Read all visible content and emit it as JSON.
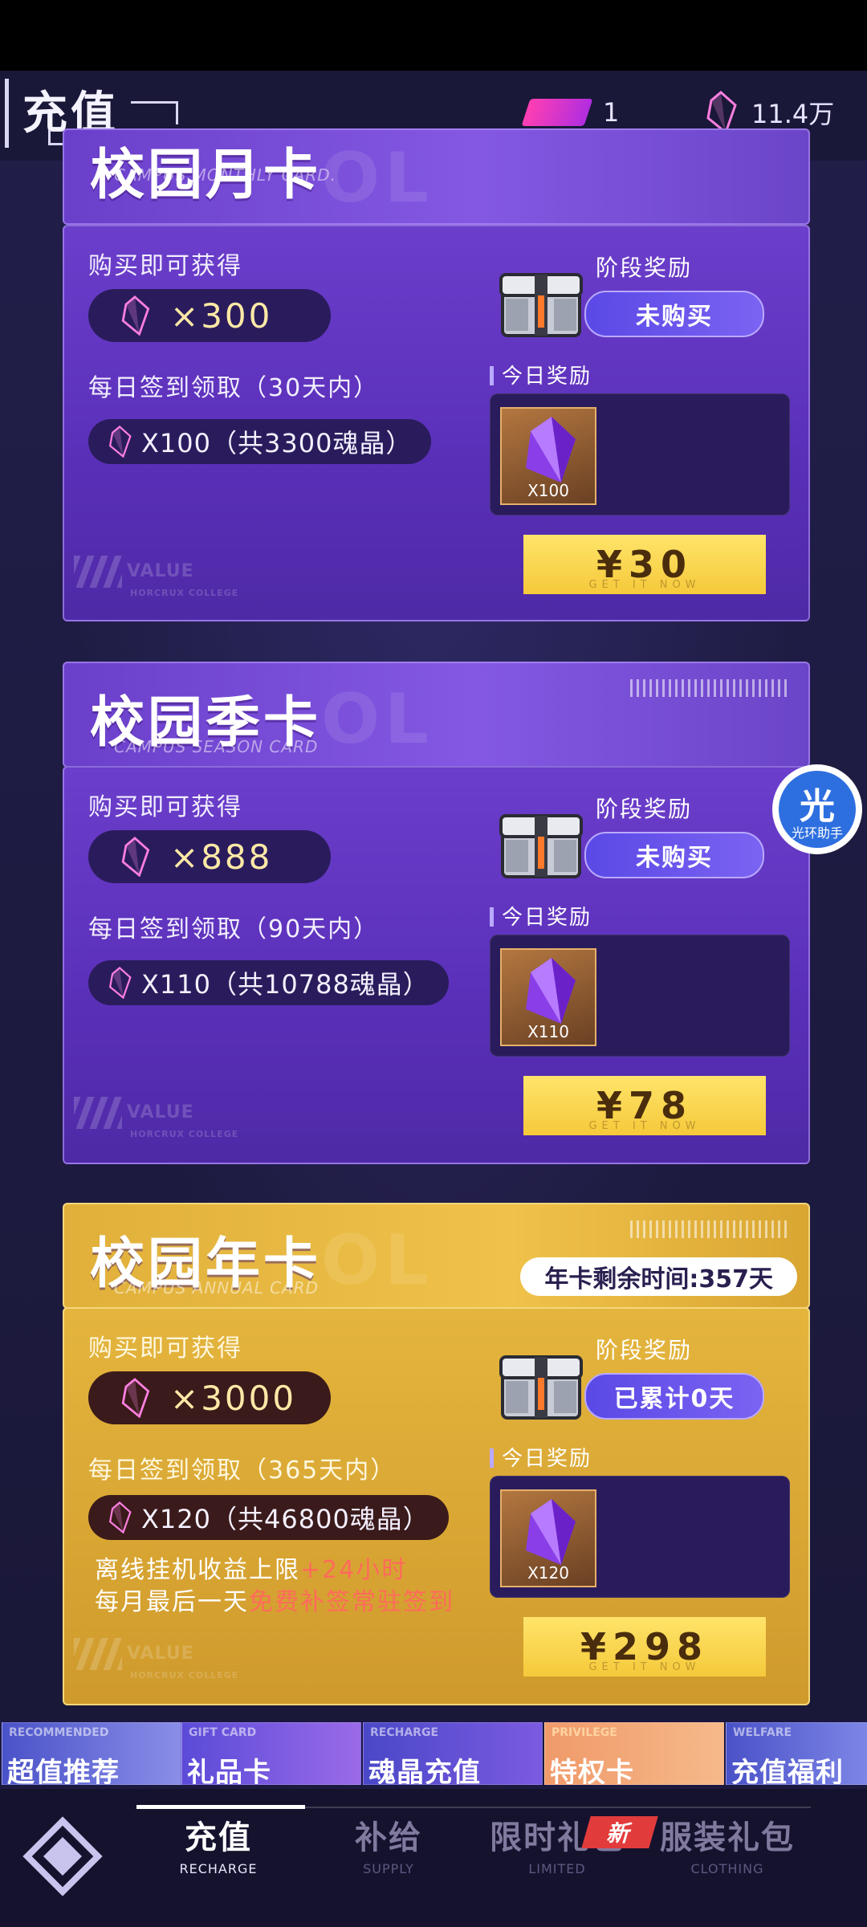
{
  "header": {
    "title": "充值"
  },
  "currency": {
    "tickets": "1",
    "crystals": "11.4万"
  },
  "helper": {
    "glyph": "光",
    "label": "光环助手"
  },
  "cards": [
    {
      "title": "校园月卡",
      "subtitle": "CAMPUS MONTHLY CARD.",
      "watermark": "OL",
      "buy_label": "购买即可获得",
      "buy_qty": "×300",
      "daily_label": "每日签到领取（30天内）",
      "daily_qty": "X100（共3300魂晶）",
      "stage_label": "阶段奖励",
      "stage_btn": "未购买",
      "today_label": "今日奖励",
      "tile_qty": "X100",
      "price": "¥30",
      "get_it_now": "GET IT NOW",
      "value_mark": "VALUE",
      "college": "HORCRUX COLLEGE"
    },
    {
      "title": "校园季卡",
      "subtitle": "CAMPUS SEASON CARD",
      "watermark": "OL",
      "buy_label": "购买即可获得",
      "buy_qty": "×888",
      "daily_label": "每日签到领取（90天内）",
      "daily_qty": "X110（共10788魂晶）",
      "stage_label": "阶段奖励",
      "stage_btn": "未购买",
      "today_label": "今日奖励",
      "tile_qty": "X110",
      "price": "¥78",
      "get_it_now": "GET IT NOW",
      "value_mark": "VALUE",
      "college": "HORCRUX COLLEGE"
    },
    {
      "title": "校园年卡",
      "subtitle": "CAMPUS ANNUAL CARD",
      "watermark": "OL",
      "remaining": "年卡剩余时间:357天",
      "buy_label": "购买即可获得",
      "buy_qty": "×3000",
      "daily_label": "每日签到领取（365天内）",
      "daily_qty": "X120（共46800魂晶）",
      "extra1_a": "离线挂机收益上限",
      "extra1_b": "+24小时",
      "extra2_a": "每月最后一天",
      "extra2_b": "免费补签常驻签到",
      "stage_label": "阶段奖励",
      "stage_btn": "已累计0天",
      "today_label": "今日奖励",
      "tile_qty": "X120",
      "price": "¥298",
      "get_it_now": "GET IT NOW",
      "value_mark": "VALUE",
      "college": "HORCRUX COLLEGE"
    }
  ],
  "categories": [
    {
      "en": "RECOMMENDED",
      "zh": "超值推荐"
    },
    {
      "en": "GIFT CARD",
      "zh": "礼品卡"
    },
    {
      "en": "RECHARGE",
      "zh": "魂晶充值"
    },
    {
      "en": "PRIVILEGE",
      "zh": "特权卡"
    },
    {
      "en": "WELFARE",
      "zh": "充值福利"
    }
  ],
  "nav": [
    {
      "zh": "充值",
      "en": "RECHARGE"
    },
    {
      "zh": "补给",
      "en": "SUPPLY"
    },
    {
      "zh": "限时礼包",
      "en": "LIMITED"
    },
    {
      "zh": "服装礼包",
      "en": "CLOTHING"
    }
  ],
  "new_badge": "新"
}
